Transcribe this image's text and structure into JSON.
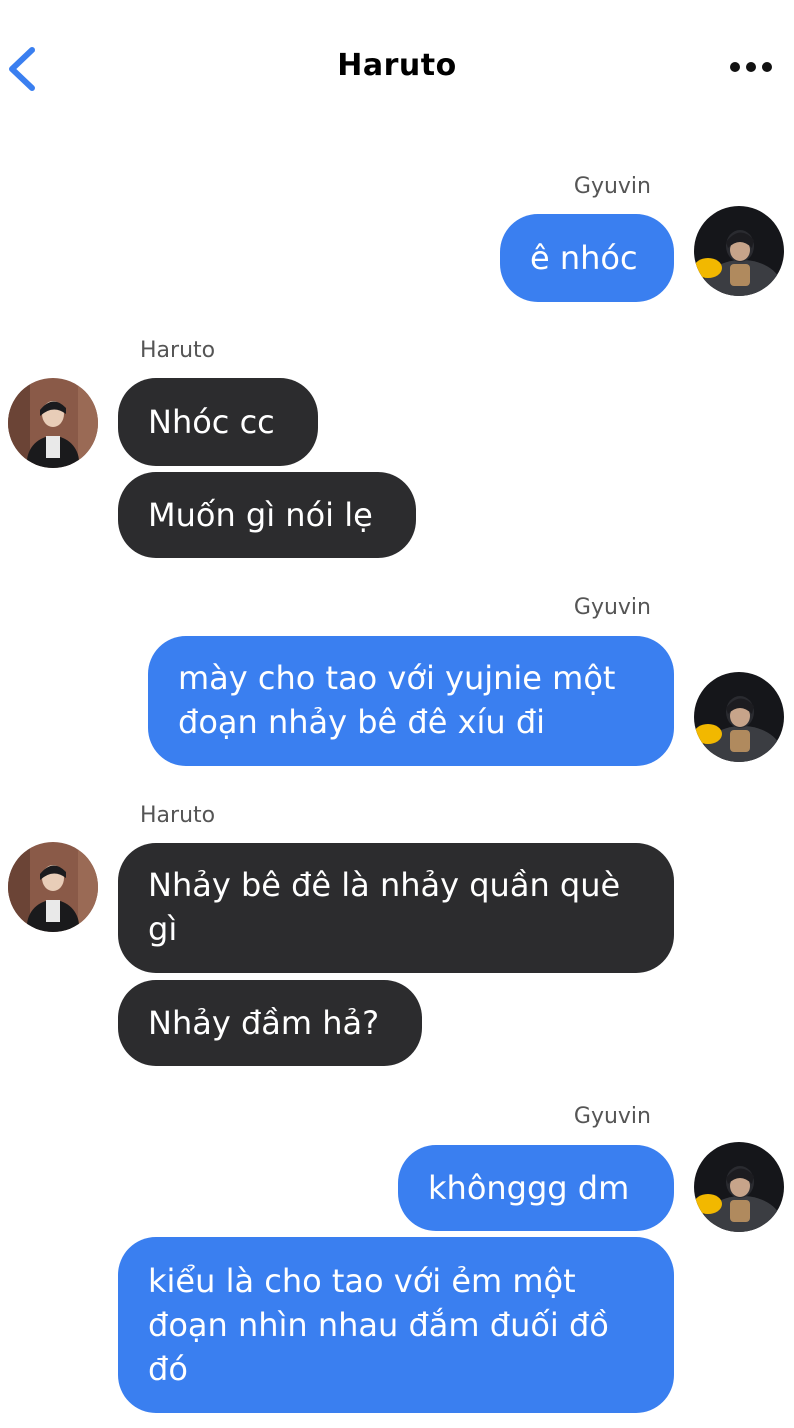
{
  "header": {
    "title": "Haruto",
    "accent_color": "#3a7ff0"
  },
  "participants": {
    "me": "Gyuvin",
    "them": "Haruto"
  },
  "messages": {
    "g1_name": "Gyuvin",
    "m1": "ê nhóc",
    "h1_name": "Haruto",
    "m2": "Nhóc cc",
    "m3": "Muốn gì nói lẹ",
    "g2_name": "Gyuvin",
    "m4a": "mày cho tao với yujnie một",
    "m4b": "đoạn nhảy bê đê xíu đi",
    "h2_name": "Haruto",
    "m5a": "Nhảy bê đê là nhảy quần què",
    "m5b": "gì",
    "m6": "Nhảy đầm hả?",
    "g3_name": "Gyuvin",
    "m7": "khônggg dm",
    "m8a": "kiểu là cho tao với ẻm một",
    "m8b": "đoạn nhìn nhau đắm đuối đồ",
    "m8c": "đó"
  },
  "colors": {
    "outgoing_bubble": "#3a7ff0",
    "incoming_bubble": "#2c2c2e",
    "sender_name": "#555555"
  }
}
